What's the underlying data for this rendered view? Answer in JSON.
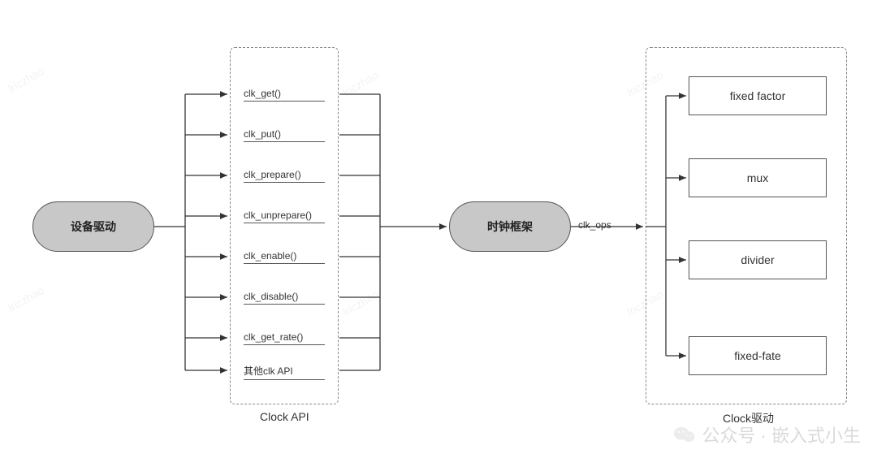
{
  "nodes": {
    "device_driver": "设备驱动",
    "clock_framework": "时钟框架",
    "clock_api_label": "Clock API",
    "clock_driver_label": "Clock驱动",
    "clk_ops_label": "clk_ops"
  },
  "api_items": [
    "clk_get()",
    "clk_put()",
    "clk_prepare()",
    "clk_unprepare()",
    "clk_enable()",
    "clk_disable()",
    "clk_get_rate()",
    "其他clk API"
  ],
  "clk_types": [
    "fixed factor",
    "mux",
    "divider",
    "fixed-fate"
  ],
  "watermark_text": "lriczhao",
  "footer_watermark": "公众号 · 嵌入式小生"
}
